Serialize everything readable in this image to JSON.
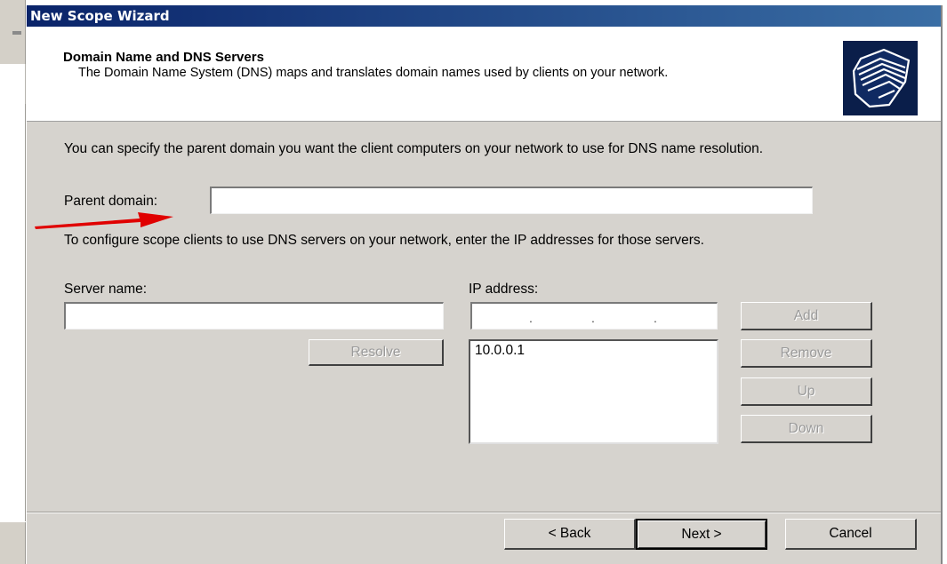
{
  "window": {
    "title": "New Scope Wizard"
  },
  "header": {
    "title": "Domain Name and DNS Servers",
    "subtitle": "The Domain Name System (DNS) maps and translates domain names used by clients on your network."
  },
  "body": {
    "intro": "You can specify the parent domain you want the client computers on your network to use for DNS name resolution.",
    "parent_domain_label": "Parent domain:",
    "parent_domain_value": "",
    "dns_instructions": "To configure scope clients to use DNS servers on your network, enter the IP addresses for those servers.",
    "server_name_label": "Server name:",
    "server_name_value": "",
    "ip_address_label": "IP address:",
    "ip_address_value": ". . .",
    "ip_list": [
      "10.0.0.1"
    ]
  },
  "buttons": {
    "resolve": "Resolve",
    "add": "Add",
    "remove": "Remove",
    "up": "Up",
    "down": "Down",
    "back": "< Back",
    "next": "Next >",
    "cancel": "Cancel"
  },
  "colors": {
    "titlebar": "#0a246a",
    "dialog_bg": "#d6d3ce",
    "annotation_arrow": "#e00000"
  },
  "icons": {
    "header": "folders-icon",
    "annotation": "red-arrow-annotation"
  }
}
